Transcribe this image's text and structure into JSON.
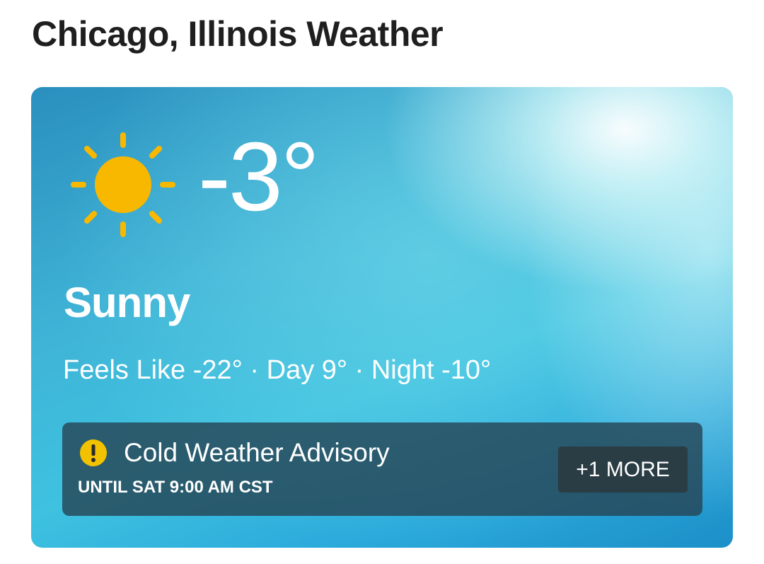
{
  "page": {
    "title": "Chicago, Illinois Weather"
  },
  "current": {
    "icon": "sun-icon",
    "temperature": "-3°",
    "condition": "Sunny",
    "details": "Feels Like -22° · Day 9° · Night -10°"
  },
  "alert": {
    "icon": "exclamation-circle-icon",
    "title": "Cold Weather Advisory",
    "until": "UNTIL SAT 9:00 AM CST",
    "more_label": "+1 MORE"
  },
  "colors": {
    "sun": "#F9B800",
    "alert_icon": "#F2C200",
    "card_blue": "#3EC2E0",
    "alert_bg": "#264656",
    "more_button_bg": "#2A3C44"
  }
}
